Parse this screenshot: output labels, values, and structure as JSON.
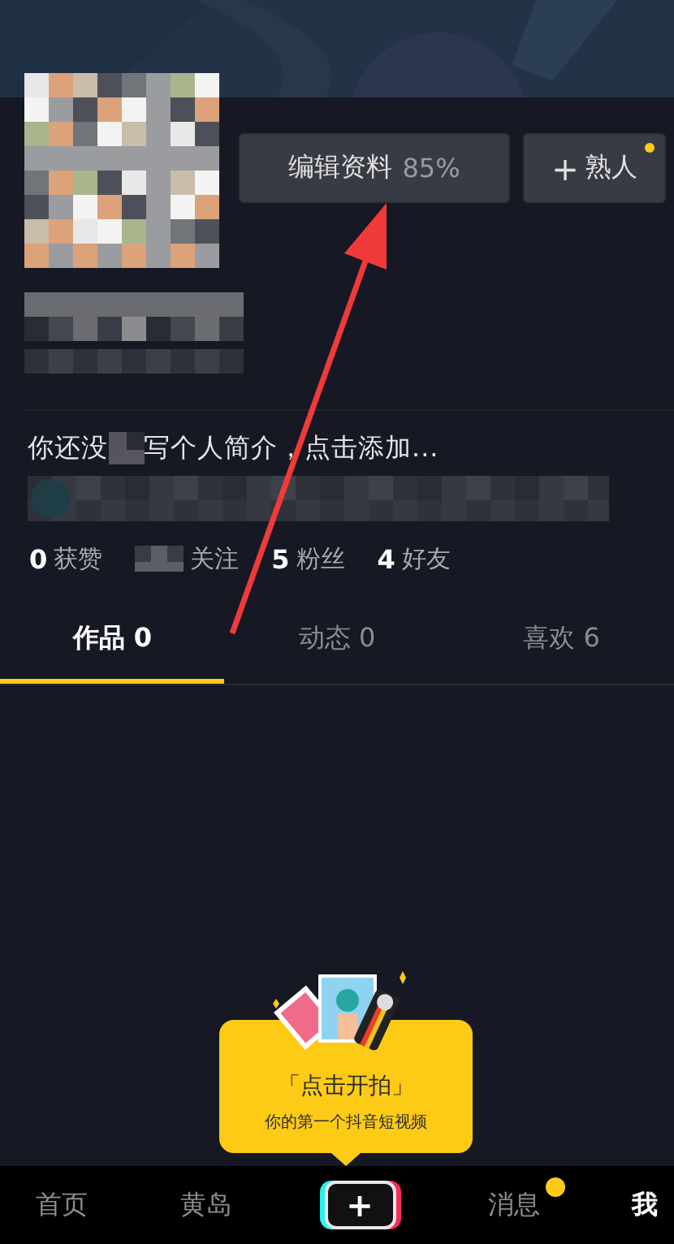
{
  "profile": {
    "edit_button": {
      "label": "编辑资料",
      "percent": "85%"
    },
    "friend_button": {
      "icon": "+",
      "label": "熟人",
      "dot": true
    }
  },
  "bio": {
    "before": "你还没",
    "after": "写个人简介，点击添加..."
  },
  "stats": [
    {
      "count": "0",
      "label": "获赞"
    },
    {
      "label": "关注"
    },
    {
      "count": "5",
      "label": "粉丝"
    },
    {
      "count": "4",
      "label": "好友"
    }
  ],
  "tabs": [
    {
      "label": "作品 0",
      "selected": true
    },
    {
      "label": "动态 0",
      "selected": false
    },
    {
      "label": "喜欢 6",
      "selected": false
    }
  ],
  "tooltip": {
    "title": "「点击开拍」",
    "subtitle": "你的第一个抖音短视频"
  },
  "nav": [
    {
      "kind": "text",
      "label": "首页",
      "selected": false
    },
    {
      "kind": "text",
      "label": "黄岛",
      "selected": false
    },
    {
      "kind": "create",
      "label": "+",
      "selected": false
    },
    {
      "kind": "text",
      "label": "消息",
      "selected": false,
      "badge": true
    },
    {
      "kind": "text",
      "label": "我",
      "selected": true
    }
  ]
}
